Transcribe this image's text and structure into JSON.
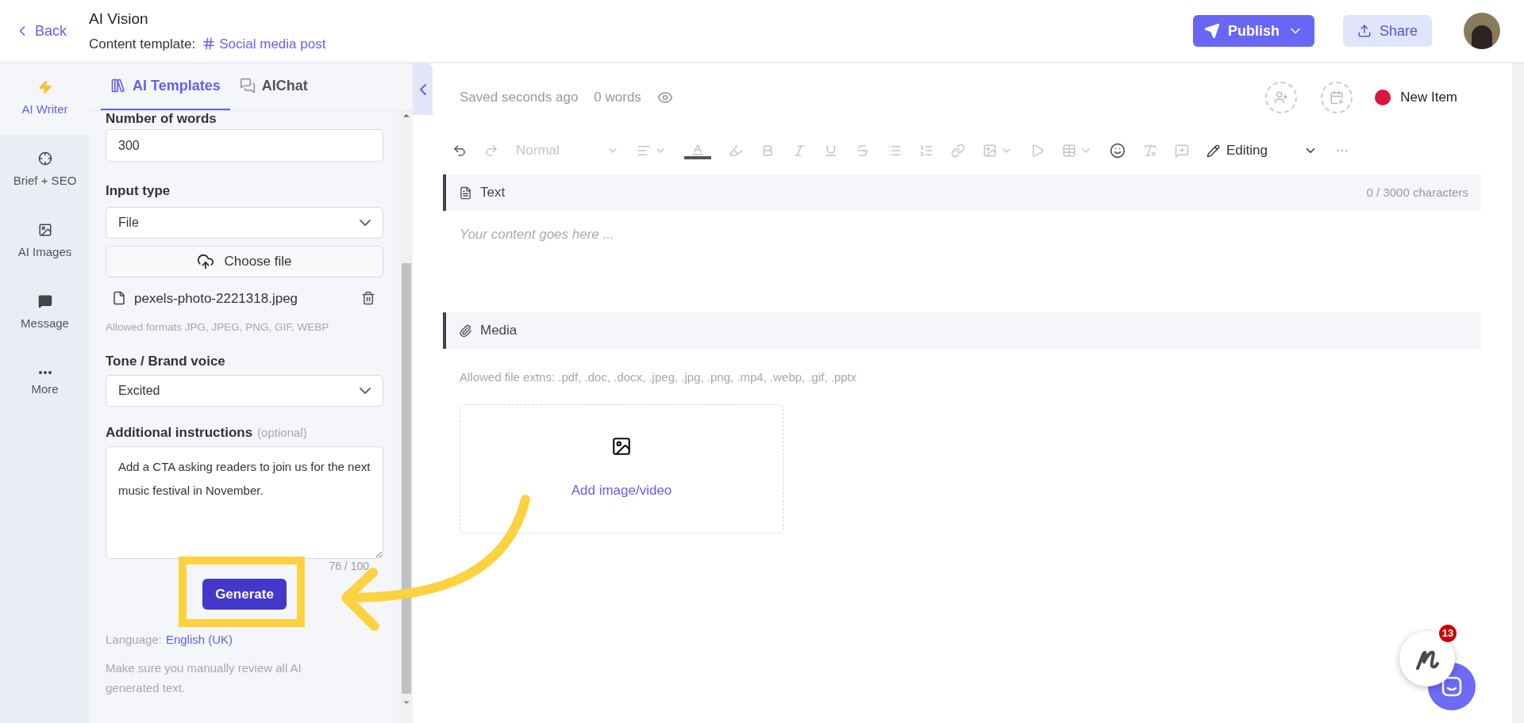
{
  "header": {
    "back": "Back",
    "title": "AI Vision",
    "template_label": "Content template:",
    "template_name": "Social media post",
    "publish": "Publish",
    "share": "Share"
  },
  "rail": [
    {
      "label": "AI Writer",
      "selected": true
    },
    {
      "label": "Brief + SEO",
      "selected": false
    },
    {
      "label": "AI Images",
      "selected": false
    },
    {
      "label": "Message",
      "selected": false
    },
    {
      "label": "More",
      "selected": false
    }
  ],
  "panel": {
    "tabs": [
      {
        "label": "AI Templates",
        "selected": true
      },
      {
        "label": "AIChat",
        "selected": false
      }
    ],
    "words_label": "Number of words",
    "words_value": "300",
    "input_type_label": "Input type",
    "input_type_value": "File",
    "choose_file": "Choose file",
    "file_name": "pexels-photo-2221318.jpeg",
    "formats_hint": "Allowed formats JPG, JPEG, PNG, GIF, WEBP",
    "tone_label": "Tone / Brand voice",
    "tone_value": "Excited",
    "instructions_label": "Additional instructions",
    "instructions_optional": "(optional)",
    "instructions_value": "Add a CTA asking readers to join us for the next music festival in November.",
    "counter": "76 / 100",
    "generate": "Generate",
    "language_label": "Language:",
    "language": "English (UK)",
    "note": "Make sure you manually review all AI generated text."
  },
  "editor": {
    "saved": "Saved seconds ago",
    "words": "0 words",
    "item_status": {
      "label": "New Item",
      "color": "#dc143c"
    },
    "toolbar": {
      "style": "Normal",
      "mode": "Editing"
    },
    "text_section": {
      "title": "Text",
      "counter": "0 / 3000 characters",
      "placeholder": "Your content goes here ..."
    },
    "media_section": {
      "title": "Media",
      "hint": "Allowed file extns: .pdf, .doc, .docx, .jpeg, .jpg, .png, .mp4, .webp, .gif, .pptx",
      "add": "Add image/video"
    }
  },
  "chat_badge": "13"
}
